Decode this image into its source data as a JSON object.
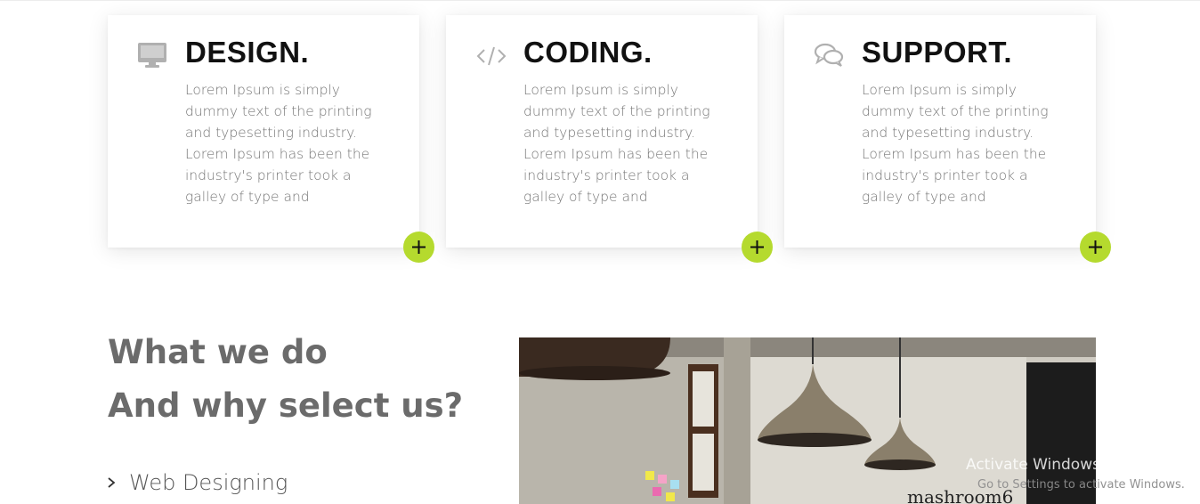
{
  "cards": [
    {
      "title": "DESIGN.",
      "icon": "monitor-icon",
      "text": "Lorem Ipsum is simply dummy text of the printing and typesetting industry. Lorem Ipsum has been the industry's printer took a galley of type and"
    },
    {
      "title": "CODING.",
      "icon": "code-icon",
      "text": "Lorem Ipsum is simply dummy text of the printing and typesetting industry. Lorem Ipsum has been the industry's printer took a galley of type and"
    },
    {
      "title": "SUPPORT.",
      "icon": "chat-bubbles-icon",
      "text": "Lorem Ipsum is simply dummy text of the printing and typesetting industry. Lorem Ipsum has been the industry's printer took a galley of type and"
    }
  ],
  "section": {
    "heading_line1": "What we do",
    "heading_line2": "And why select us?",
    "list": [
      {
        "label": "Web Designing",
        "icon": "chevron-right-icon"
      }
    ],
    "photo_caption": "mashroom6"
  },
  "watermark": {
    "line1": "Activate Windows",
    "line2": "Go to Settings to activate Windows."
  },
  "colors": {
    "accent": "#b5da2e",
    "heading": "#6b6b6b",
    "body_text": "#777777",
    "icon_gray": "#b0b0b0"
  }
}
